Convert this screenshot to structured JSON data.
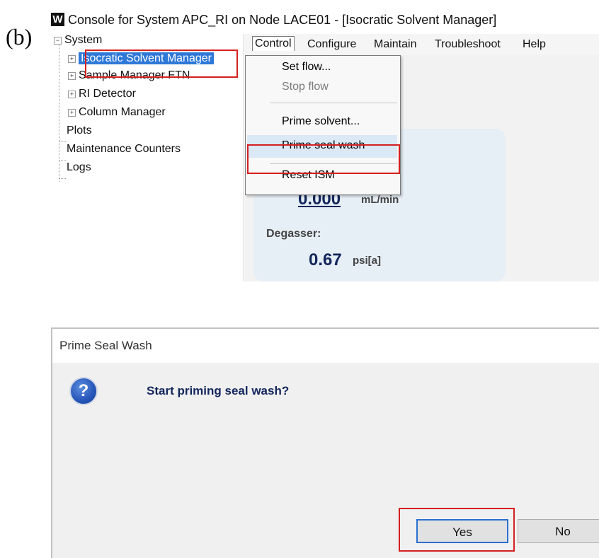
{
  "panel_label": "(b)",
  "console": {
    "app_icon": "W",
    "title": "Console for System APC_RI on Node LACE01 - [Isocratic Solvent Manager]",
    "tree": {
      "root": "System",
      "children": [
        "Isocratic Solvent Manager",
        "Sample Manager FTN",
        "RI Detector",
        "Column Manager"
      ],
      "other": [
        "Plots",
        "Maintenance Counters",
        "Logs"
      ]
    },
    "menubar": [
      "Control",
      "Configure",
      "Maintain",
      "Troubleshoot",
      "Help"
    ],
    "control_menu": {
      "items": [
        "Set flow...",
        "Stop flow",
        "Prime solvent...",
        "Prime seal wash",
        "Reset ISM"
      ],
      "disabled": [
        "Stop flow"
      ],
      "highlighted": "Prime seal wash"
    },
    "readouts": {
      "flow_value": "0.000",
      "flow_unit": "mL/min",
      "degasser_label": "Degasser:",
      "degasser_value": "0.67",
      "degasser_unit": "psi[a]"
    }
  },
  "dialog": {
    "title": "Prime Seal Wash",
    "icon": "question-icon",
    "message": "Start priming seal wash?",
    "yes_label": "Yes",
    "no_label": "No"
  },
  "colors": {
    "highlight_box": "#d42020",
    "selection": "#2e78d8",
    "default_button_border": "#2a6fd1"
  }
}
